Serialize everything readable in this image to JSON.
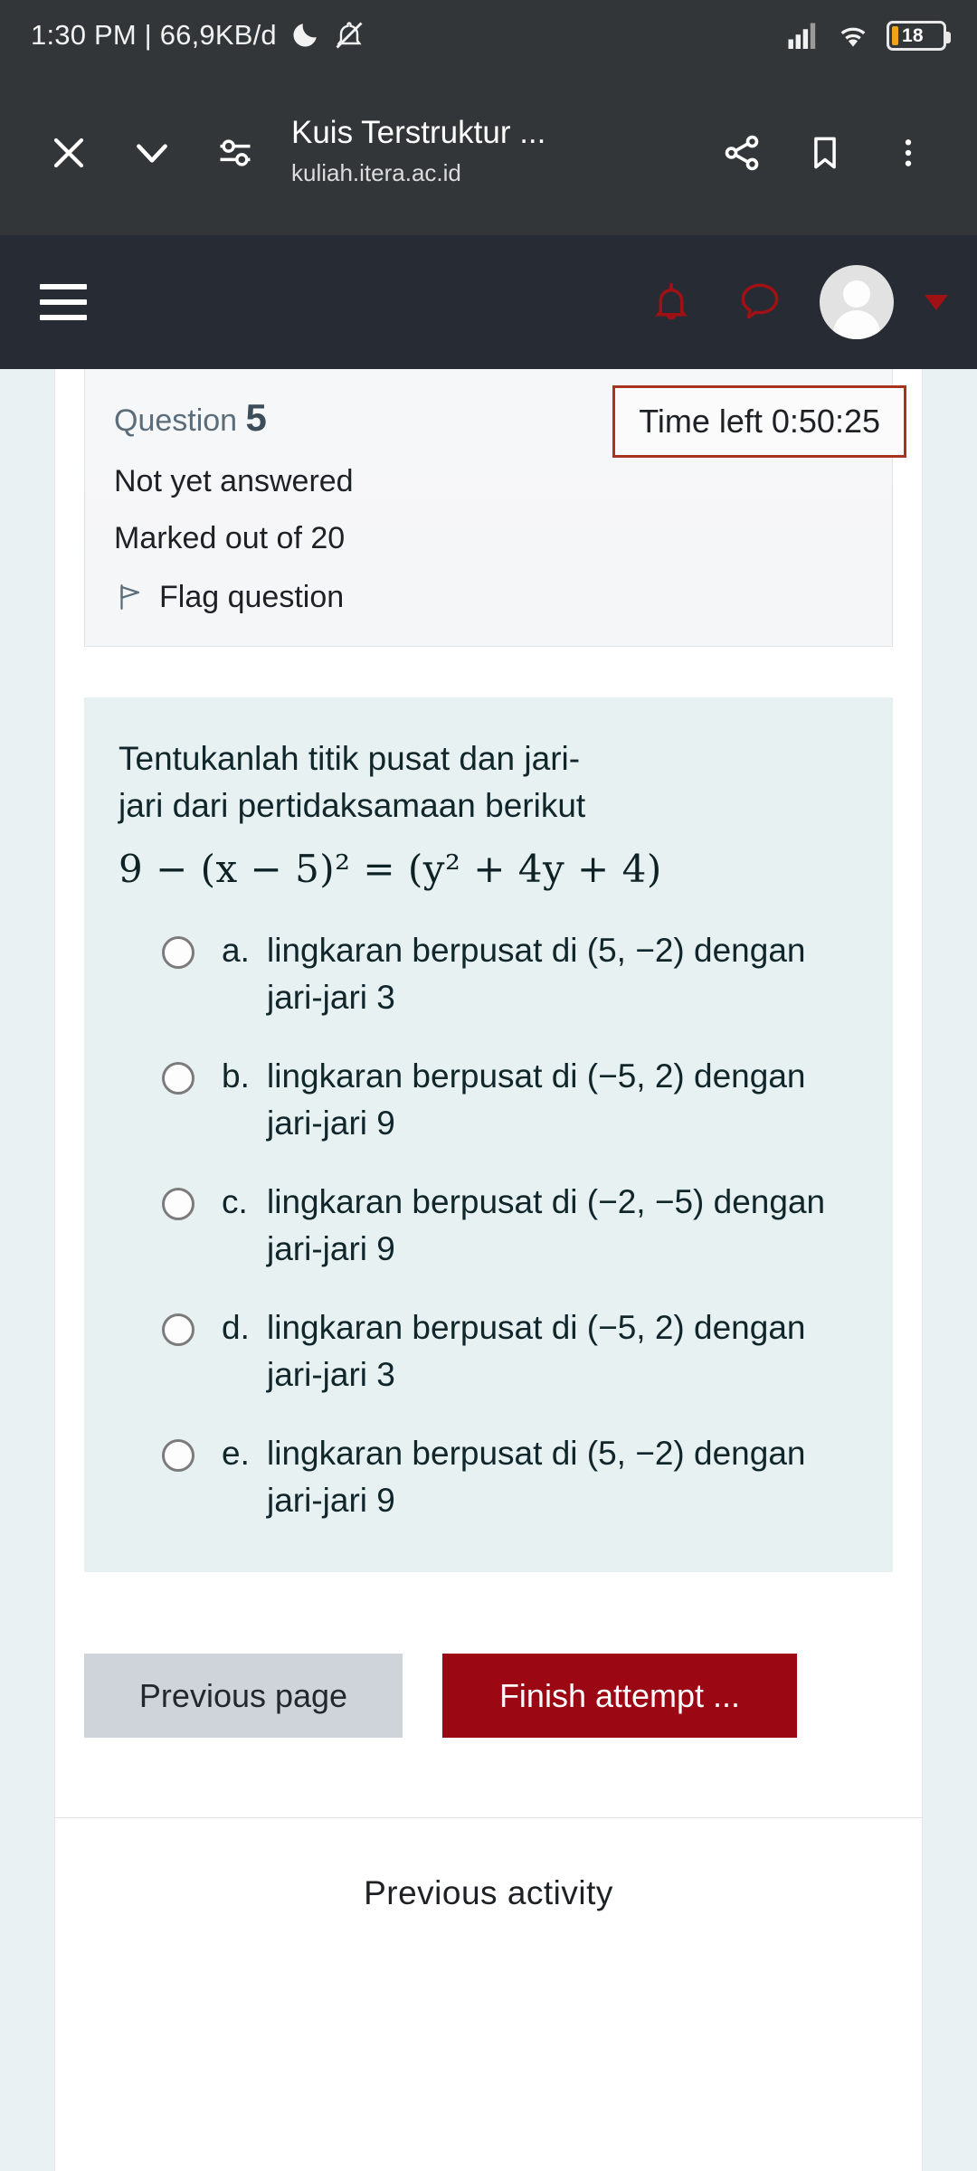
{
  "statusbar": {
    "time_and_data": "1:30 PM | 66,9KB/d",
    "dnd_icon": "crescent-moon-icon",
    "mute_icon": "bell-muted-icon",
    "signal_icon": "cellular-signal-icon",
    "wifi_icon": "wifi-icon",
    "battery_level": "18"
  },
  "browserbar": {
    "close_icon": "close-icon",
    "collapse_icon": "chevron-down-icon",
    "tune_icon": "page-settings-icon",
    "title": "Kuis Terstruktur ...",
    "url": "kuliah.itera.ac.id",
    "share_icon": "share-icon",
    "bookmark_icon": "bookmark-icon",
    "overflow_icon": "more-vertical-icon"
  },
  "sitenav": {
    "menu_icon": "hamburger-menu-icon",
    "notifications_icon": "bell-icon",
    "messages_icon": "speech-bubble-icon",
    "avatar_icon": "user-avatar-icon",
    "caret_icon": "caret-down-icon",
    "accent_color": "#a01116",
    "background_color": "#272b33"
  },
  "question_info": {
    "question_label": "Question",
    "question_number": "5",
    "state": "Not yet answered",
    "marks": "Marked out of 20",
    "flag_icon": "flag-icon",
    "flag_label": "Flag question",
    "timer_text": "Time left 0:50:25",
    "timer_border_color": "#a8331f"
  },
  "question": {
    "text_line1": "Tentukanlah titik pusat dan jari-",
    "text_line2": "jari dari pertidaksamaan berikut",
    "formula": "9 − (x − 5)² = (y² + 4y + 4)",
    "background_color": "#e7f1f2",
    "options": [
      {
        "key": "a.",
        "text": "lingkaran berpusat di (5, −2) dengan jari-jari 3",
        "selected": false
      },
      {
        "key": "b.",
        "text": "lingkaran berpusat di (−5, 2) dengan jari-jari 9",
        "selected": false
      },
      {
        "key": "c.",
        "text": "lingkaran berpusat di (−2, −5) dengan jari-jari 9",
        "selected": false
      },
      {
        "key": "d.",
        "text": "lingkaran berpusat di (−5, 2) dengan jari-jari 3",
        "selected": false
      },
      {
        "key": "e.",
        "text": "lingkaran berpusat di (5, −2) dengan jari-jari 9",
        "selected": false
      }
    ]
  },
  "actions": {
    "previous_page": "Previous page",
    "finish_attempt": "Finish attempt ...",
    "previous_page_color": "#ced4da",
    "finish_attempt_color": "#9b0712"
  },
  "footer": {
    "previous_activity": "Previous activity"
  }
}
